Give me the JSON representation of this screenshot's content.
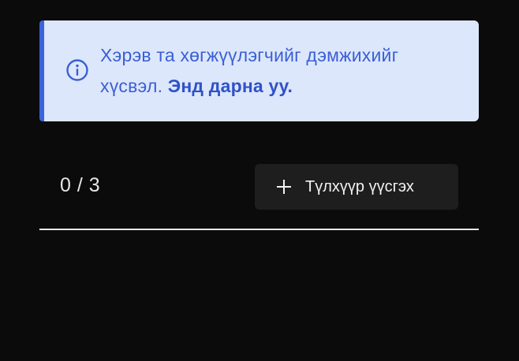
{
  "notice": {
    "text": "Хэрэв та хөгжүүлэгчийг дэмжихийг хүсвэл. ",
    "link_label": "Энд дарна уу.",
    "icon": "info-icon",
    "colors": {
      "background": "#dde7fb",
      "accent": "#3a63dc",
      "text": "#3a5fd6"
    }
  },
  "keys": {
    "count_label": "0 / 3",
    "create_button_label": "Түлхүүр үүсгэх",
    "create_button_icon": "plus-icon"
  }
}
